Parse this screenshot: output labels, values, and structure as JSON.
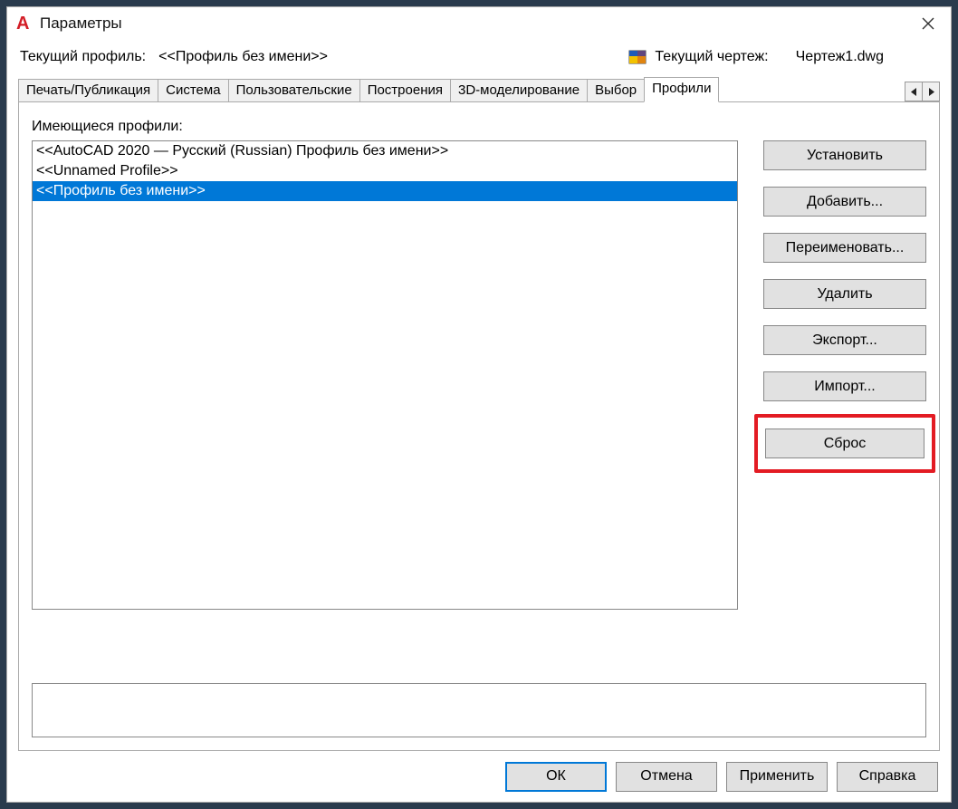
{
  "window": {
    "title": "Параметры"
  },
  "header": {
    "current_profile_label": "Текущий профиль:",
    "current_profile_value": "<<Профиль без имени>>",
    "current_drawing_label": "Текущий чертеж:",
    "current_drawing_value": "Чертеж1.dwg"
  },
  "tabs": {
    "items": [
      {
        "label": "Печать/Публикация"
      },
      {
        "label": "Система"
      },
      {
        "label": "Пользовательские"
      },
      {
        "label": "Построения"
      },
      {
        "label": "3D-моделирование"
      },
      {
        "label": "Выбор"
      },
      {
        "label": "Профили"
      }
    ],
    "active_index": 6
  },
  "profiles": {
    "label": "Имеющиеся профили:",
    "items": [
      {
        "name": "<<AutoCAD 2020 — Русский (Russian) Профиль без имени>>",
        "selected": false
      },
      {
        "name": "<<Unnamed Profile>>",
        "selected": false
      },
      {
        "name": "<<Профиль без имени>>",
        "selected": true
      }
    ]
  },
  "side_buttons": {
    "set_current": "Установить",
    "add": "Добавить...",
    "rename": "Переименовать...",
    "delete": "Удалить",
    "export": "Экспорт...",
    "import": "Импорт...",
    "reset": "Сброс"
  },
  "footer": {
    "ok": "ОК",
    "cancel": "Отмена",
    "apply": "Применить",
    "help": "Справка"
  }
}
